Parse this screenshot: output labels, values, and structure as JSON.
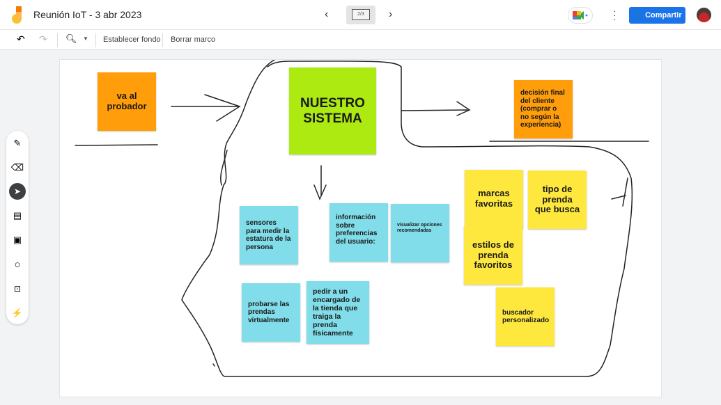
{
  "header": {
    "title": "Reunión IoT - 3 abr 2023",
    "frame_indicator": "2/3",
    "share_label": "Compartir"
  },
  "toolbar": {
    "set_background": "Establecer fondo",
    "clear_frame": "Borrar marco"
  },
  "notes": [
    {
      "text": "va al probador",
      "color": "#ff9d0a"
    },
    {
      "text": "NUESTRO SISTEMA",
      "color": "#acea12"
    },
    {
      "text": "decisión final del cliente (comprar o no según la experiencia)",
      "color": "#ff9d0a"
    },
    {
      "text": "sensores para medir la estatura de la persona",
      "color": "#80dde9"
    },
    {
      "text": "información sobre preferencias del usuario:",
      "color": "#80dde9"
    },
    {
      "text": "visualizar opciones recomendadas",
      "color": "#80dde9"
    },
    {
      "text": "probarse las prendas virtualmente",
      "color": "#80dde9"
    },
    {
      "text": "pedir a un encargado de la tienda que traiga la prenda físicamente",
      "color": "#80dde9"
    },
    {
      "text": "marcas favoritas",
      "color": "#ffe83d"
    },
    {
      "text": "tipo de prenda que busca",
      "color": "#ffe83d"
    },
    {
      "text": "estilos de prenda favoritos",
      "color": "#ffe83d"
    },
    {
      "text": "buscador personalizado",
      "color": "#ffe83d"
    }
  ]
}
